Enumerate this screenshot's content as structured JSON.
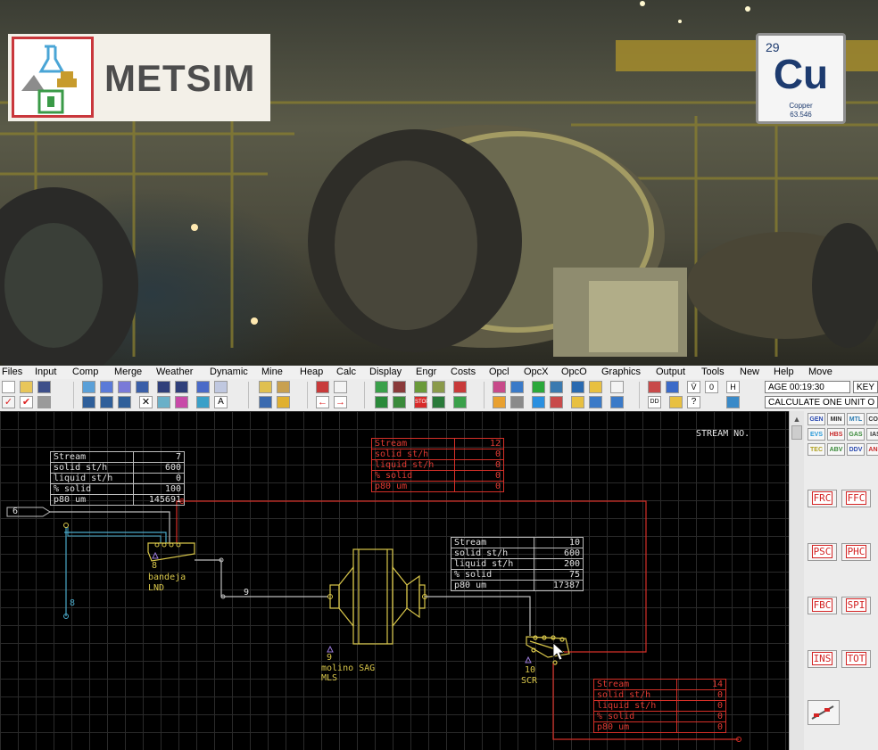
{
  "banner": {
    "logo_text": "METSIM",
    "element": {
      "number": "29",
      "symbol": "Cu",
      "name": "Copper",
      "mass": "63.546"
    }
  },
  "menu": [
    "Files",
    "Input",
    "Comp",
    "Merge",
    "Weather",
    "Dynamic",
    "Mine",
    "Heap",
    "Calc",
    "Display",
    "Engr",
    "Costs",
    "Opcl",
    "OpcX",
    "OpcO",
    "Graphics",
    "Output",
    "Tools",
    "New",
    "Help",
    "Move"
  ],
  "toolbar": {
    "clock": "AGE 00:19:30",
    "key": "KEY",
    "status": "CALCULATE ONE UNIT O"
  },
  "canvas": {
    "header": "STREAM NO.",
    "row_labels": [
      "Stream",
      "solid st/h",
      "liquid st/h",
      "% solid",
      "p80 um"
    ],
    "tables": [
      {
        "id": "s7",
        "values": [
          "7",
          "600",
          "0",
          "100",
          "145691"
        ]
      },
      {
        "id": "s12",
        "values": [
          "12",
          "0",
          "0",
          "0",
          "0"
        ]
      },
      {
        "id": "s10",
        "values": [
          "10",
          "600",
          "200",
          "75",
          "17387"
        ]
      },
      {
        "id": "s14",
        "values": [
          "14",
          "0",
          "0",
          "0",
          "0"
        ]
      }
    ],
    "feed_stream": "6",
    "stream_labels": {
      "s8": "8",
      "s9": "9"
    },
    "units": [
      {
        "number": "8",
        "name": "bandeja",
        "code": "LND"
      },
      {
        "number": "9",
        "name": "molino SAG",
        "code": "MLS"
      },
      {
        "number": "10",
        "name": "",
        "code": "SCR"
      }
    ]
  },
  "palette": {
    "mini": [
      "GEN",
      "MIN",
      "MTL",
      "COS",
      "EVS",
      "HBS",
      "GAS",
      "IAS",
      "TEC",
      "ABV",
      "DDV",
      "ANN"
    ],
    "units": [
      "FRC",
      "FFC",
      "PSC",
      "PHC",
      "FBC",
      "SPI",
      "INS",
      "TOT"
    ]
  },
  "colors": {
    "red": "#d63028",
    "yellow": "#d8c64a",
    "cyan": "#4aa9c9",
    "grey": "#bdbdbd"
  }
}
